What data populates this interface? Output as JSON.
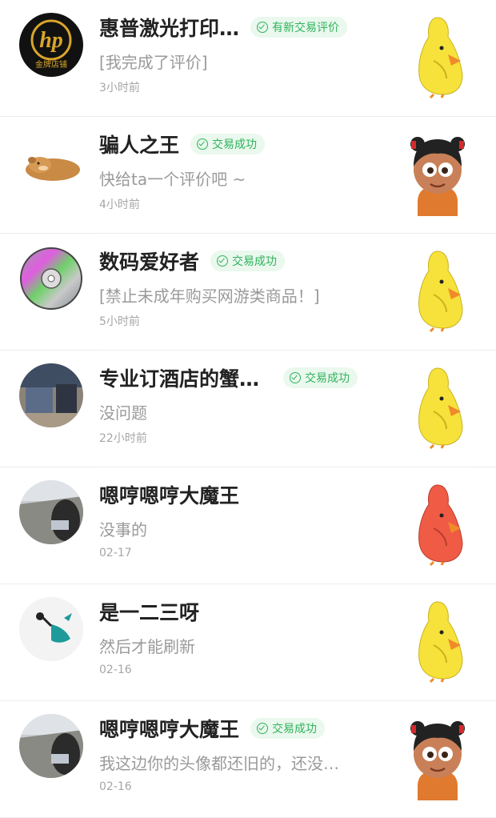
{
  "conversations": [
    {
      "name": "惠普激光打印…",
      "badge": "有新交易评价",
      "message": "[我完成了评价]",
      "time": "3小时前",
      "avatar": "hp-logo",
      "logo_text": "hp",
      "logo_sub": "金牌店铺",
      "sticker": "yellow-duck-sticker"
    },
    {
      "name": "骗人之王",
      "badge": "交易成功",
      "message": "快给ta一个评价吧 ~",
      "time": "4小时前",
      "avatar": "bear-avatar",
      "sticker": "cartoon-girl-sticker"
    },
    {
      "name": "数码爱好者",
      "badge": "交易成功",
      "message": "[禁止未成年购买网游类商品！]",
      "time": "5小时前",
      "avatar": "cd-disc-avatar",
      "sticker": "yellow-duck-sticker"
    },
    {
      "name": "专业订酒店的蟹…",
      "badge": "交易成功",
      "message": "没问题",
      "time": "22小时前",
      "avatar": "photo-avatar",
      "sticker": "yellow-duck-sticker"
    },
    {
      "name": "嗯哼嗯哼大魔王",
      "badge": "",
      "message": "没事的",
      "time": "02-17",
      "avatar": "photo-avatar",
      "sticker": "red-duck-sticker"
    },
    {
      "name": "是一二三呀",
      "badge": "",
      "message": "然后才能刷新",
      "time": "02-16",
      "avatar": "illustration-avatar",
      "sticker": "yellow-duck-sticker"
    },
    {
      "name": "嗯哼嗯哼大魔王",
      "badge": "交易成功",
      "message": "我这边你的头像都还旧的，还没…",
      "time": "02-16",
      "avatar": "photo-avatar",
      "sticker": "cartoon-girl-sticker"
    }
  ],
  "colors": {
    "badge_text": "#2fb35b",
    "badge_bg": "#eaf8ee",
    "yellow_duck": "#f6e23a",
    "red_duck": "#ef5b45"
  }
}
